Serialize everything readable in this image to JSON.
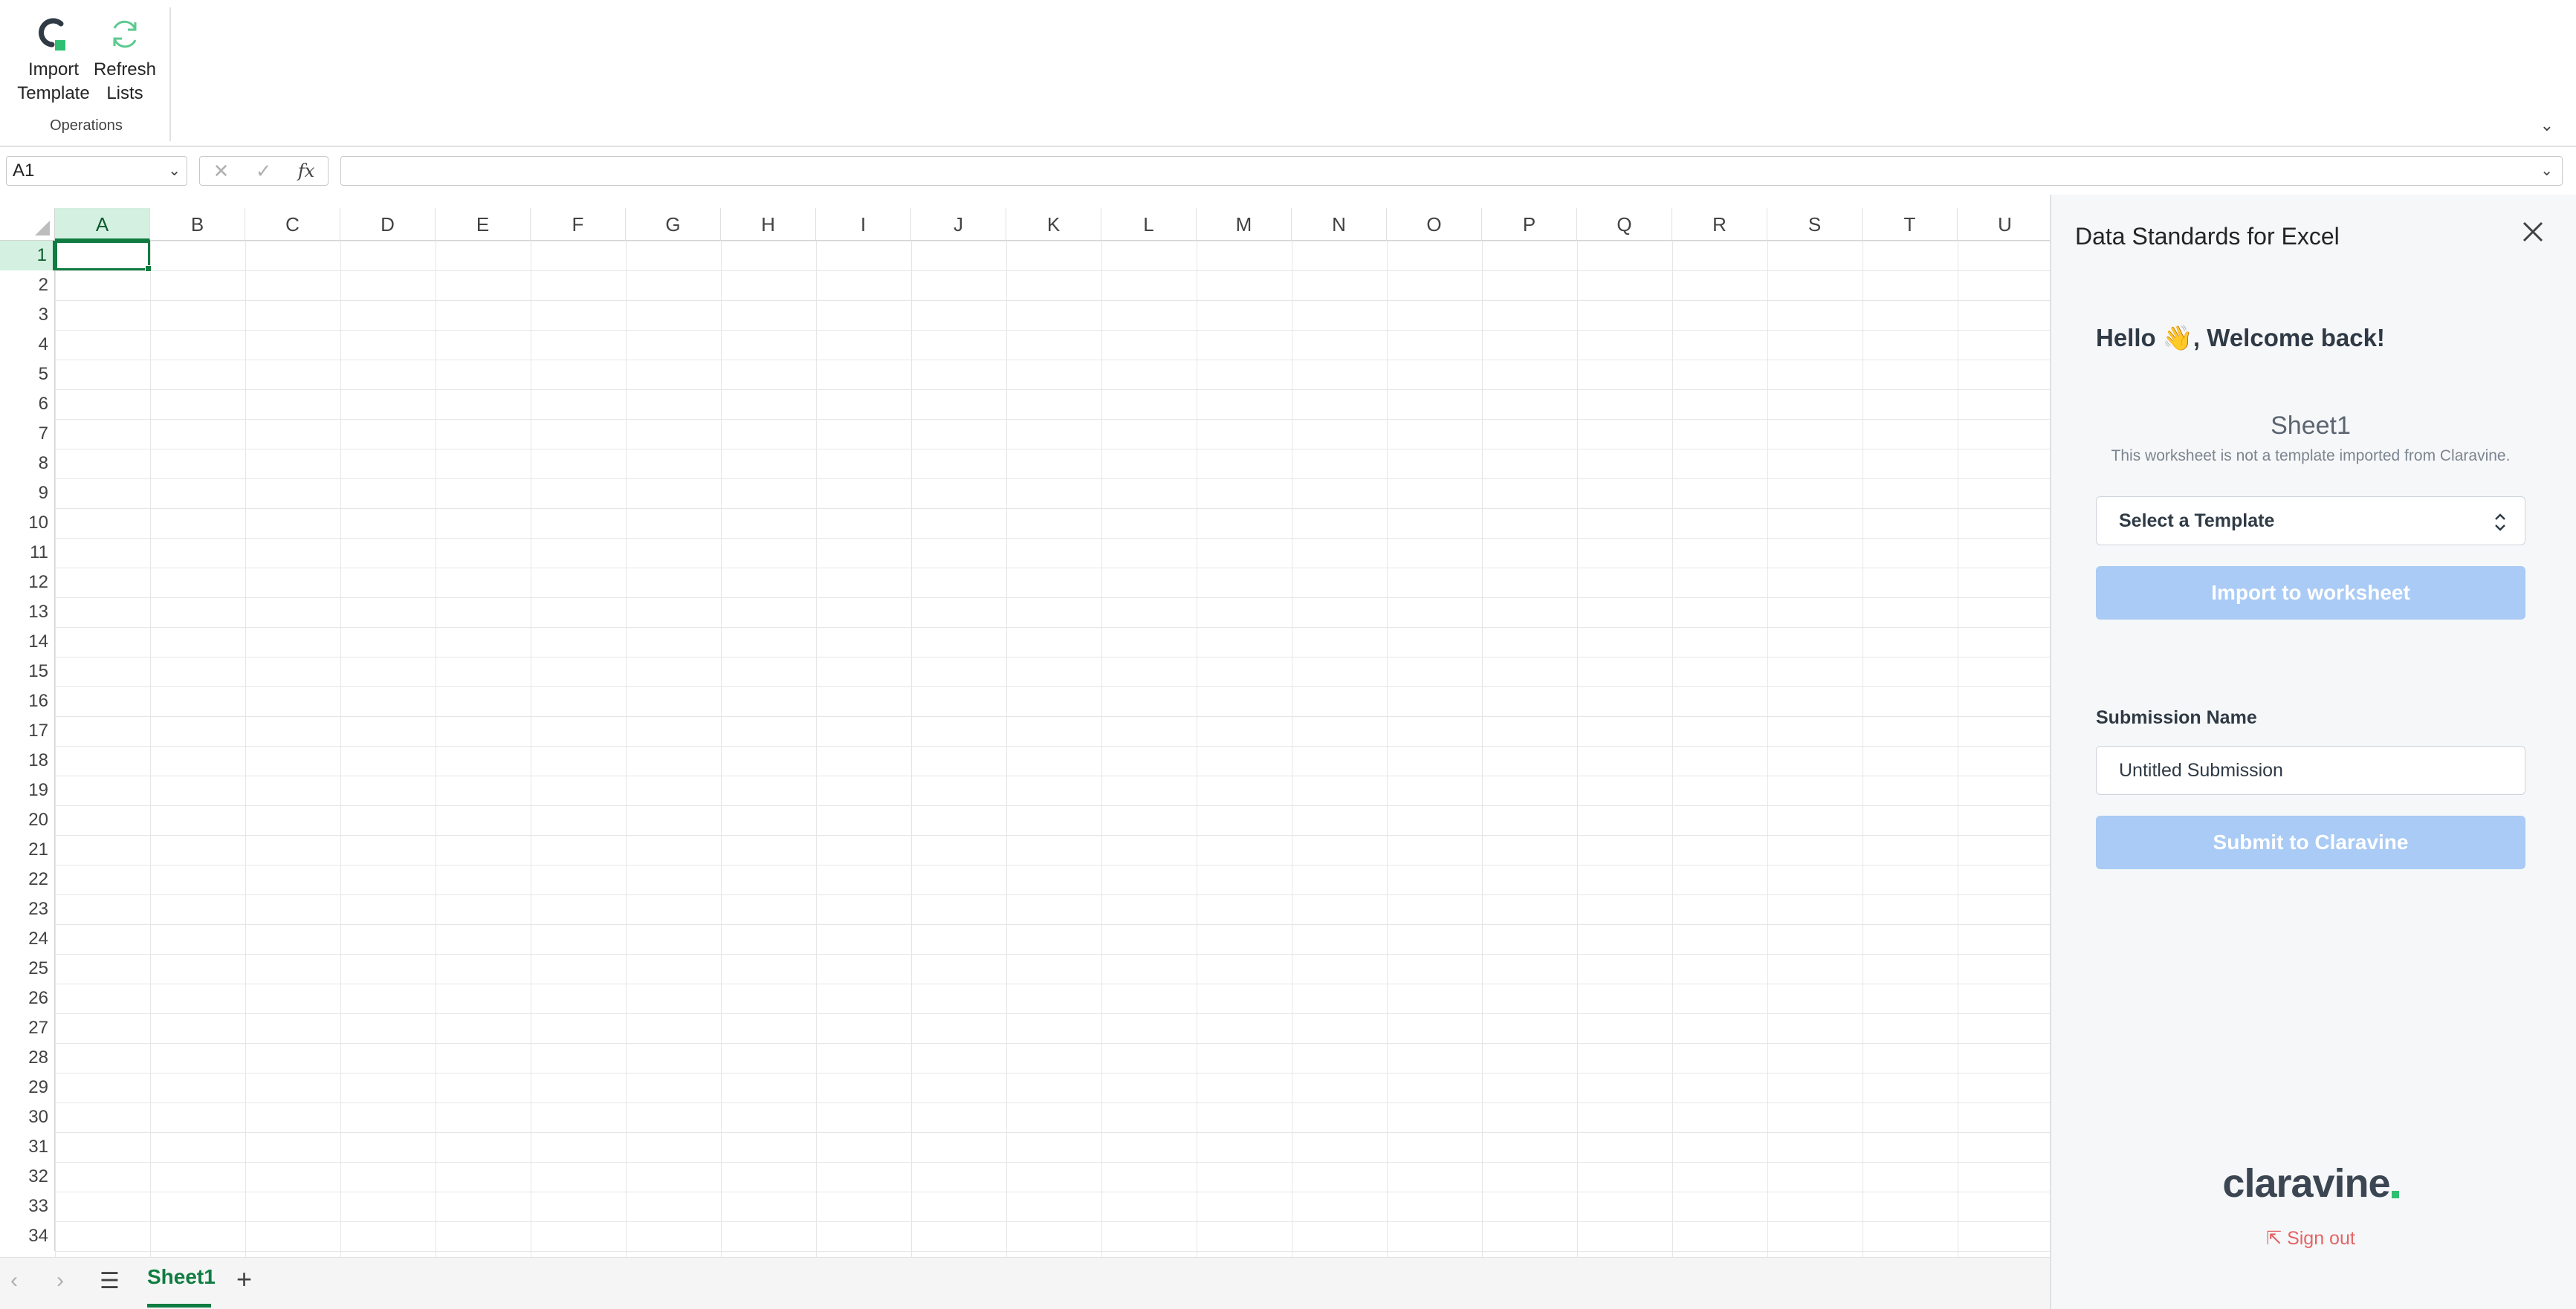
{
  "ribbon": {
    "import_template": "Import Template",
    "refresh_lists": "Refresh Lists",
    "group_label": "Operations",
    "import_line1": "Import",
    "import_line2": "Template",
    "refresh_line1": "Refresh",
    "refresh_line2": "Lists"
  },
  "formula_bar": {
    "name_box": "A1",
    "fx_label": "fx",
    "formula": ""
  },
  "grid": {
    "columns": [
      "A",
      "B",
      "C",
      "D",
      "E",
      "F",
      "G",
      "H",
      "I",
      "J",
      "K",
      "L",
      "M",
      "N",
      "O",
      "P",
      "Q",
      "R",
      "S",
      "T",
      "U"
    ],
    "rows": [
      "1",
      "2",
      "3",
      "4",
      "5",
      "6",
      "7",
      "8",
      "9",
      "10",
      "11",
      "12",
      "13",
      "14",
      "15",
      "16",
      "17",
      "18",
      "19",
      "20",
      "21",
      "22",
      "23",
      "24",
      "25",
      "26",
      "27",
      "28",
      "29",
      "30",
      "31",
      "32",
      "33",
      "34"
    ],
    "selected_cell": "A1"
  },
  "sheet_tabs": {
    "active": "Sheet1"
  },
  "pane": {
    "title": "Data Standards for Excel",
    "greeting": "Hello 👋, Welcome back!",
    "sheet_name": "Sheet1",
    "sheet_note": "This worksheet is not a template imported from Claravine.",
    "template_select": "Select a Template",
    "import_button": "Import to worksheet",
    "submission_label": "Submission Name",
    "submission_value": "Untitled Submission",
    "submit_button": "Submit to Claravine",
    "logo": "claravine",
    "sign_out": "Sign out",
    "button_color": "#a9cbf5",
    "signout_color": "#e46464"
  },
  "colors": {
    "excel_green": "#107c41",
    "selection_fill": "#d3f0e0"
  }
}
